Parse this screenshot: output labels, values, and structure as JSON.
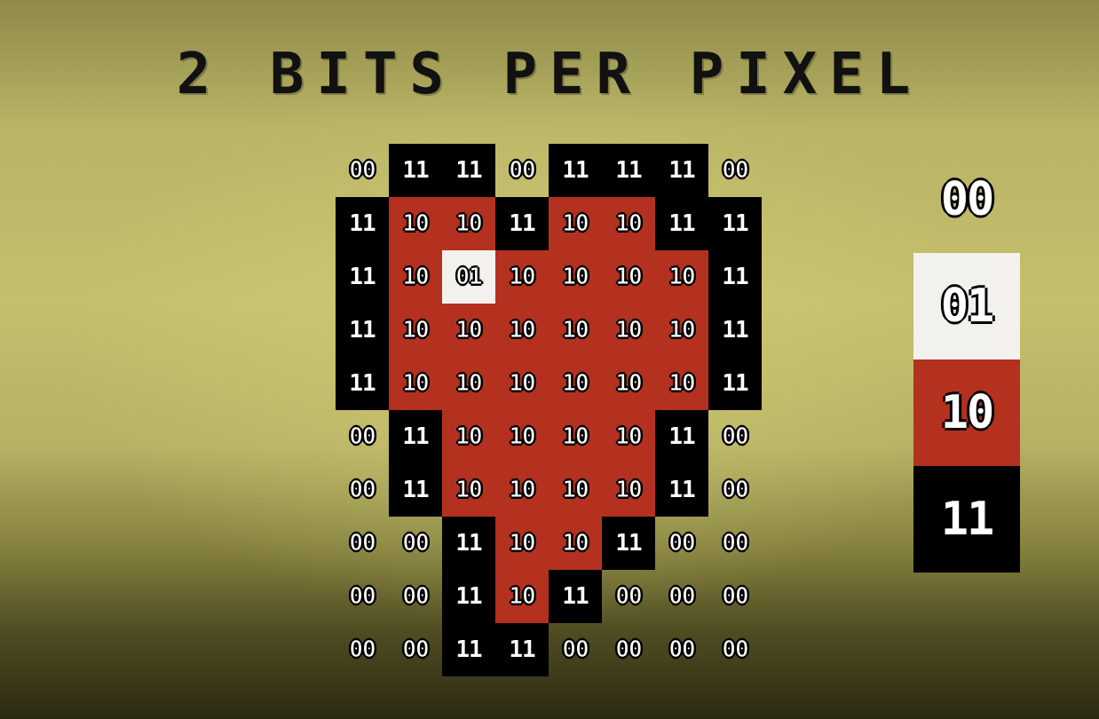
{
  "title": "2 BITS PER PIXEL",
  "grid": [
    [
      "00",
      "11",
      "11",
      "00",
      "11",
      "11",
      "11",
      "00"
    ],
    [
      "11",
      "10",
      "10",
      "11",
      "10",
      "10",
      "11",
      "11"
    ],
    [
      "11",
      "10",
      "01",
      "10",
      "10",
      "10",
      "10",
      "11"
    ],
    [
      "11",
      "10",
      "10",
      "10",
      "10",
      "10",
      "10",
      "11"
    ],
    [
      "11",
      "10",
      "10",
      "10",
      "10",
      "10",
      "10",
      "11"
    ],
    [
      "00",
      "11",
      "10",
      "10",
      "10",
      "10",
      "11",
      "00"
    ],
    [
      "00",
      "11",
      "10",
      "10",
      "10",
      "10",
      "11",
      "00"
    ],
    [
      "00",
      "00",
      "11",
      "10",
      "10",
      "11",
      "00",
      "00"
    ],
    [
      "00",
      "00",
      "11",
      "10",
      "11",
      "00",
      "00",
      "00"
    ],
    [
      "00",
      "00",
      "11",
      "11",
      "00",
      "00",
      "00",
      "00"
    ]
  ],
  "palette": {
    "00": "transparent",
    "01": "#f3f1ee",
    "10": "#b4311f",
    "11": "#000000"
  },
  "legend": [
    "00",
    "01",
    "10",
    "11"
  ]
}
